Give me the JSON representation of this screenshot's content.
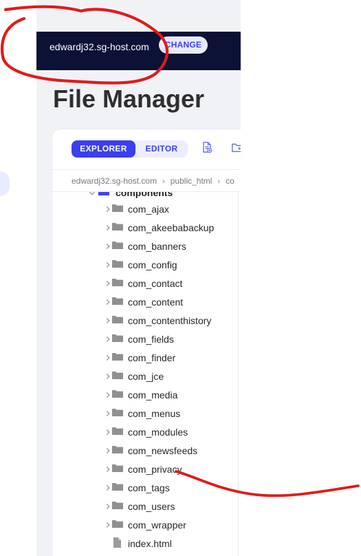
{
  "header": {
    "site_name": "edwardj32.sg-host.com",
    "change_label": "CHANGE"
  },
  "page": {
    "title": "File Manager"
  },
  "toolbar": {
    "tabs": [
      {
        "label": "EXPLORER",
        "selected": true
      },
      {
        "label": "EDITOR",
        "selected": false
      }
    ],
    "icons": [
      "new-file-icon",
      "new-folder-icon"
    ]
  },
  "breadcrumb": {
    "items": [
      "edwardj32.sg-host.com",
      "public_html",
      "co"
    ]
  },
  "tree": {
    "expanded_folder": "components",
    "items": [
      {
        "label": "com_ajax",
        "type": "folder"
      },
      {
        "label": "com_akeebabackup",
        "type": "folder"
      },
      {
        "label": "com_banners",
        "type": "folder"
      },
      {
        "label": "com_config",
        "type": "folder"
      },
      {
        "label": "com_contact",
        "type": "folder"
      },
      {
        "label": "com_content",
        "type": "folder"
      },
      {
        "label": "com_contenthistory",
        "type": "folder"
      },
      {
        "label": "com_fields",
        "type": "folder"
      },
      {
        "label": "com_finder",
        "type": "folder"
      },
      {
        "label": "com_jce",
        "type": "folder"
      },
      {
        "label": "com_media",
        "type": "folder"
      },
      {
        "label": "com_menus",
        "type": "folder"
      },
      {
        "label": "com_modules",
        "type": "folder"
      },
      {
        "label": "com_newsfeeds",
        "type": "folder"
      },
      {
        "label": "com_privacy",
        "type": "folder"
      },
      {
        "label": "com_tags",
        "type": "folder"
      },
      {
        "label": "com_users",
        "type": "folder"
      },
      {
        "label": "com_wrapper",
        "type": "folder"
      },
      {
        "label": "index.html",
        "type": "file"
      }
    ]
  },
  "colors": {
    "topbar": "#0c1235",
    "accent": "#3c3ef0",
    "accent_soft": "#e8eaff",
    "annotation": "#e11a1a"
  }
}
